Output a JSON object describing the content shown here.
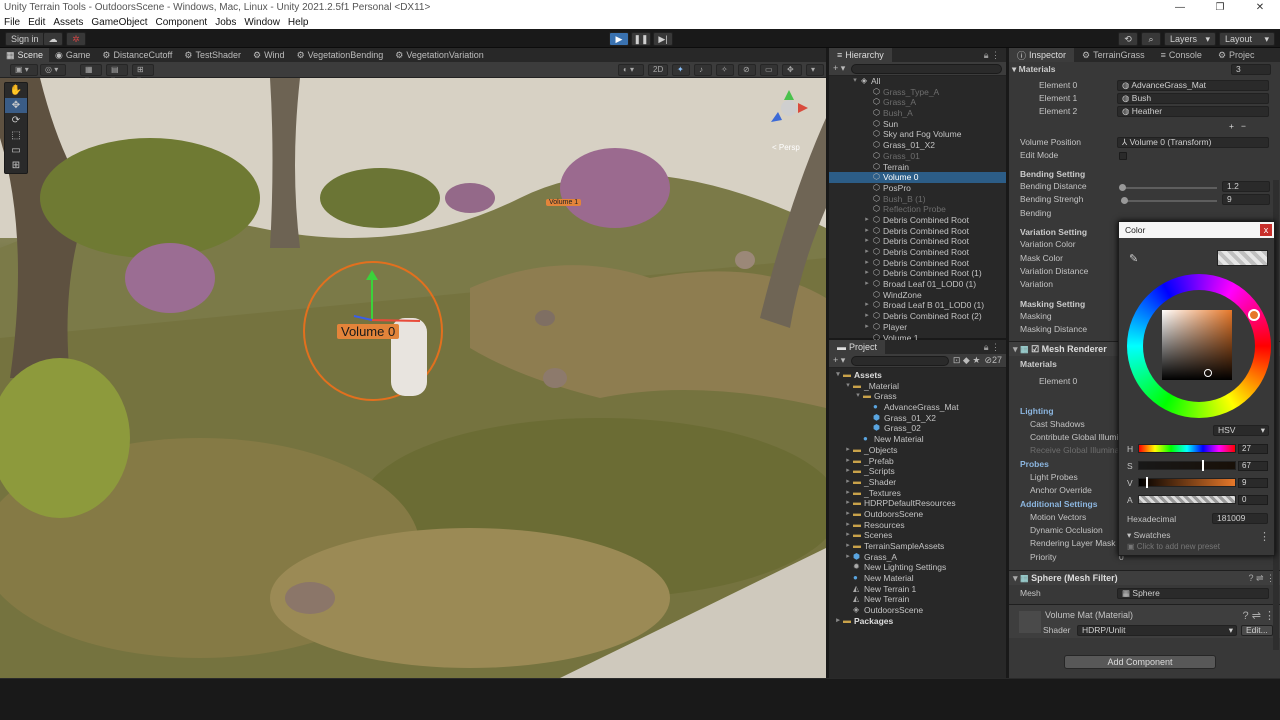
{
  "window": {
    "title": "Unity Terrain Tools - OutdoorsScene - Windows, Mac, Linux - Unity 2021.2.5f1 Personal <DX11>",
    "controls": [
      "—",
      "❐",
      "✕"
    ]
  },
  "menu": [
    "File",
    "Edit",
    "Assets",
    "GameObject",
    "Component",
    "Jobs",
    "Window",
    "Help"
  ],
  "toolbar": {
    "sign_in": "Sign in",
    "layers": "Layers",
    "layout": "Layout"
  },
  "scene_tabs": [
    "Scene",
    "Game",
    "DistanceCutoff",
    "TestShader",
    "Wind",
    "VegetationBending",
    "VegetationVariation"
  ],
  "scene_toolbar": {
    "mode_2d": "2D",
    "persp_label": "< Persp"
  },
  "viewport": {
    "volume_label": "Volume 0",
    "volume1_label": "Volume 1"
  },
  "hierarchy": {
    "tab": "Hierarchy",
    "root": "All",
    "items": [
      {
        "label": "Grass_Type_A",
        "dim": true
      },
      {
        "label": "Grass_A",
        "dim": true
      },
      {
        "label": "Bush_A",
        "dim": true
      },
      {
        "label": "Sun",
        "dim": false
      },
      {
        "label": "Sky and Fog Volume",
        "dim": false
      },
      {
        "label": "Grass_01_X2",
        "dim": false
      },
      {
        "label": "Grass_01",
        "dim": true
      },
      {
        "label": "Terrain",
        "dim": false
      },
      {
        "label": "Volume 0",
        "dim": false,
        "selected": true
      },
      {
        "label": "PosPro",
        "dim": false
      },
      {
        "label": "Bush_B (1)",
        "dim": true
      },
      {
        "label": "Reflection Probe",
        "dim": true
      },
      {
        "label": "Debris Combined Root",
        "dim": false,
        "expand": true
      },
      {
        "label": "Debris Combined Root",
        "dim": false,
        "expand": true
      },
      {
        "label": "Debris Combined Root",
        "dim": false,
        "expand": true
      },
      {
        "label": "Debris Combined Root",
        "dim": false,
        "expand": true
      },
      {
        "label": "Debris Combined Root",
        "dim": false,
        "expand": true
      },
      {
        "label": "Debris Combined Root (1)",
        "dim": false,
        "expand": true
      },
      {
        "label": "Broad Leaf 01_LOD0 (1)",
        "dim": false,
        "expand": true
      },
      {
        "label": "WindZone",
        "dim": false
      },
      {
        "label": "Broad Leaf B 01_LOD0 (1)",
        "dim": false,
        "expand": true
      },
      {
        "label": "Debris Combined Root (2)",
        "dim": false,
        "expand": true
      },
      {
        "label": "Player",
        "dim": false,
        "expand": true
      },
      {
        "label": "Volume 1",
        "dim": false
      }
    ]
  },
  "project": {
    "tab": "Project",
    "badge_count": "27",
    "items": [
      {
        "label": "Assets",
        "indent": 0,
        "bold": true,
        "icon": "folder-icon",
        "arrow": "▾"
      },
      {
        "label": "_Material",
        "indent": 1,
        "icon": "folder-icon",
        "arrow": "▾"
      },
      {
        "label": "Grass",
        "indent": 2,
        "icon": "folder-icon",
        "arrow": "▾"
      },
      {
        "label": "AdvanceGrass_Mat",
        "indent": 3,
        "icon": "material-icon"
      },
      {
        "label": "Grass_01_X2",
        "indent": 3,
        "icon": "prefab-icon"
      },
      {
        "label": "Grass_02",
        "indent": 3,
        "icon": "prefab-icon"
      },
      {
        "label": "New Material",
        "indent": 2,
        "icon": "material-icon"
      },
      {
        "label": "_Objects",
        "indent": 1,
        "icon": "folder-icon",
        "arrow": "▸"
      },
      {
        "label": "_Prefab",
        "indent": 1,
        "icon": "folder-icon",
        "arrow": "▸"
      },
      {
        "label": "_Scripts",
        "indent": 1,
        "icon": "folder-icon",
        "arrow": "▸"
      },
      {
        "label": "_Shader",
        "indent": 1,
        "icon": "folder-icon",
        "arrow": "▸"
      },
      {
        "label": "_Textures",
        "indent": 1,
        "icon": "folder-icon",
        "arrow": "▸"
      },
      {
        "label": "HDRPDefaultResources",
        "indent": 1,
        "icon": "folder-icon",
        "arrow": "▸"
      },
      {
        "label": "OutdoorsScene",
        "indent": 1,
        "icon": "folder-icon",
        "arrow": "▸"
      },
      {
        "label": "Resources",
        "indent": 1,
        "icon": "folder-icon",
        "arrow": "▸"
      },
      {
        "label": "Scenes",
        "indent": 1,
        "icon": "folder-icon",
        "arrow": "▸"
      },
      {
        "label": "TerrainSampleAssets",
        "indent": 1,
        "icon": "folder-icon",
        "arrow": "▸"
      },
      {
        "label": "Grass_A",
        "indent": 1,
        "icon": "prefab-icon",
        "arrow": "▸"
      },
      {
        "label": "New Lighting Settings",
        "indent": 1,
        "icon": "lighting-icon"
      },
      {
        "label": "New Material",
        "indent": 1,
        "icon": "material-icon"
      },
      {
        "label": "New Terrain 1",
        "indent": 1,
        "icon": "terrain-icon"
      },
      {
        "label": "New Terrain",
        "indent": 1,
        "icon": "terrain-icon"
      },
      {
        "label": "OutdoorsScene",
        "indent": 1,
        "icon": "scene-icon"
      },
      {
        "label": "Packages",
        "indent": 0,
        "bold": true,
        "icon": "folder-icon",
        "arrow": "▸"
      }
    ]
  },
  "inspector": {
    "tabs": [
      "Inspector",
      "TerrainGrass",
      "Console",
      "Projec"
    ],
    "materials_header": "Materials",
    "materials_count": "3",
    "elements": [
      {
        "label": "Element 0",
        "value": "AdvanceGrass_Mat"
      },
      {
        "label": "Element 1",
        "value": "Bush"
      },
      {
        "label": "Element 2",
        "value": "Heather"
      }
    ],
    "volume_position_label": "Volume Position",
    "volume_position_value": "Volume 0 (Transform)",
    "edit_mode_label": "Edit Mode",
    "bending_setting": "Bending Setting",
    "bending_distance_label": "Bending Distance",
    "bending_distance_value": "1.2",
    "bending_strength_label": "Bending Strengh",
    "bending_strength_value": "9",
    "bending_label": "Bending",
    "variation_setting": "Variation Setting",
    "variation_color": "Variation Color",
    "mask_color": "Mask Color",
    "variation_distance": "Variation Distance",
    "variation": "Variation",
    "masking_setting": "Masking Setting",
    "masking": "Masking",
    "masking_distance": "Masking Distance",
    "mesh_renderer": "Mesh Renderer",
    "mr_materials": "Materials",
    "mr_element0": "Element 0",
    "lighting": "Lighting",
    "cast_shadows": "Cast Shadows",
    "contribute_gi": "Contribute Global Illumi",
    "receive_gi": "Receive Global Illumina",
    "probes": "Probes",
    "light_probes": "Light Probes",
    "anchor_override": "Anchor Override",
    "additional_settings": "Additional Settings",
    "motion_vectors": "Motion Vectors",
    "dynamic_occlusion": "Dynamic Occlusion",
    "rendering_layer_mask": "Rendering Layer Mask",
    "priority": "Priority",
    "priority_value": "0",
    "mesh_filter": "Sphere (Mesh Filter)",
    "mesh_label": "Mesh",
    "mesh_value": "Sphere",
    "volume_mat": "Volume Mat (Material)",
    "shader_label": "Shader",
    "shader_value": "HDRP/Unlit",
    "edit_button": "Edit...",
    "add_component": "Add Component"
  },
  "color_picker": {
    "title": "Color",
    "close": "x",
    "mode": "HSV",
    "h_label": "H",
    "h_value": "27",
    "s_label": "S",
    "s_value": "67",
    "v_label": "V",
    "v_value": "9",
    "a_label": "A",
    "a_value": "0",
    "hex_label": "Hexadecimal",
    "hex_value": "181009",
    "swatches": "Swatches",
    "swatch_hint": "Click to add new preset",
    "hue_knob_color": "#e6782a"
  }
}
